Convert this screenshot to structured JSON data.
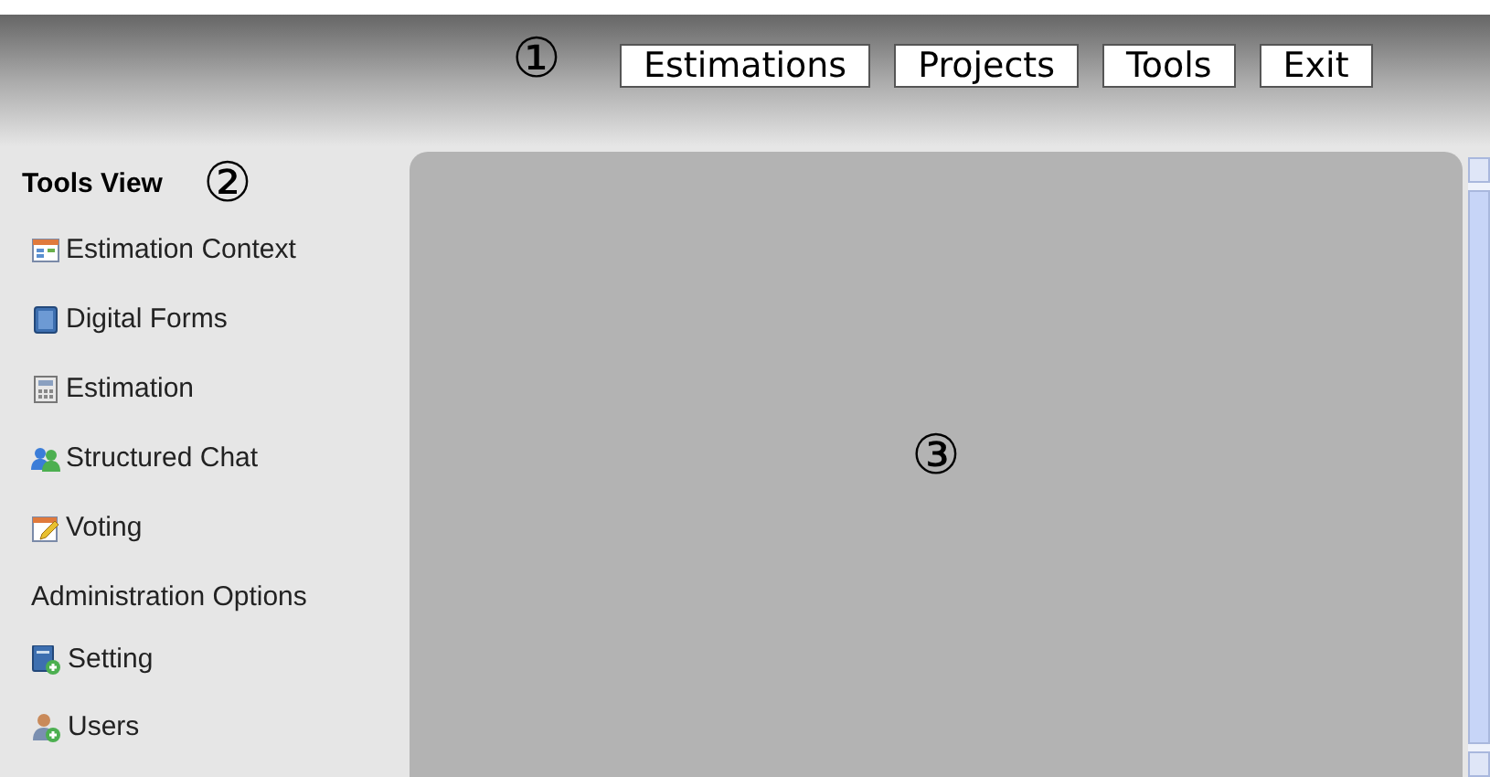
{
  "header": {
    "marker": "①",
    "nav": [
      {
        "label": "Estimations"
      },
      {
        "label": "Projects"
      },
      {
        "label": "Tools"
      },
      {
        "label": "Exit"
      }
    ]
  },
  "sidebar": {
    "title": "Tools View",
    "marker": "②",
    "items": [
      {
        "label": "Estimation Context"
      },
      {
        "label": "Digital Forms"
      },
      {
        "label": "Estimation"
      },
      {
        "label": "Structured Chat"
      },
      {
        "label": "Voting"
      }
    ],
    "admin_title": "Administration Options",
    "admin_items": [
      {
        "label": "Setting"
      },
      {
        "label": "Users"
      }
    ]
  },
  "main": {
    "marker": "③"
  }
}
